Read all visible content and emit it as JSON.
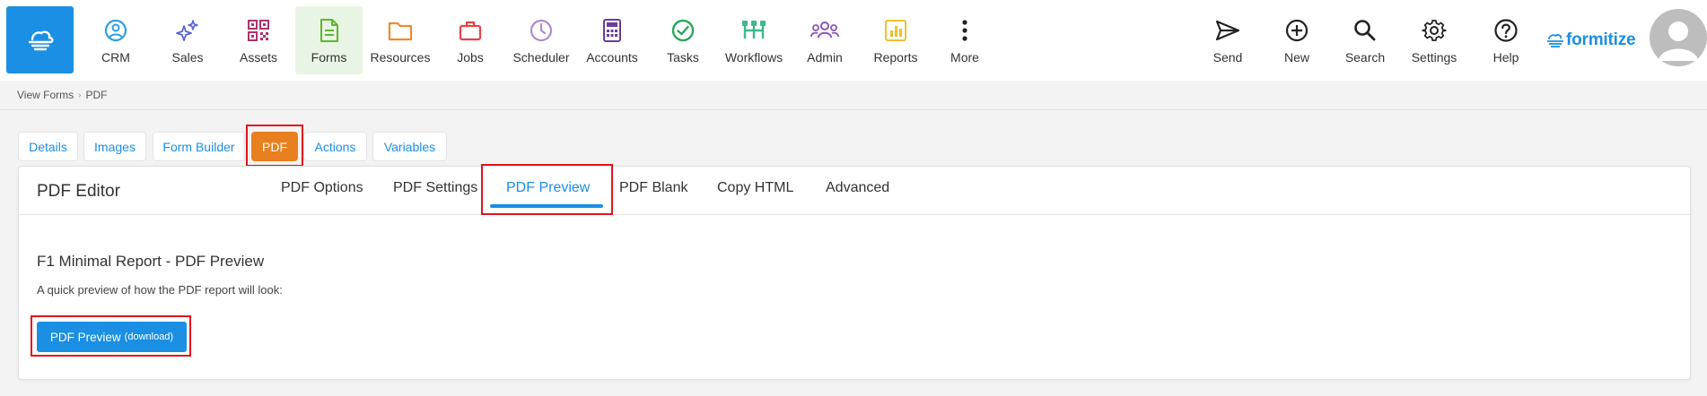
{
  "nav": {
    "items": [
      {
        "label": "CRM",
        "icon": "smile-icon",
        "color": "#2aa0e0"
      },
      {
        "label": "Sales",
        "icon": "sparkles-icon",
        "color": "#5a63d8"
      },
      {
        "label": "Assets",
        "icon": "qr-code-icon",
        "color": "#b0306e"
      },
      {
        "label": "Forms",
        "icon": "document-icon",
        "color": "#5cb82e"
      },
      {
        "label": "Resources",
        "icon": "folder-icon",
        "color": "#f28a2e"
      },
      {
        "label": "Jobs",
        "icon": "briefcase-icon",
        "color": "#e8424a"
      },
      {
        "label": "Scheduler",
        "icon": "clock-icon",
        "color": "#b08ad0"
      },
      {
        "label": "Accounts",
        "icon": "calculator-icon",
        "color": "#6a3c9a"
      },
      {
        "label": "Tasks",
        "icon": "check-circle-icon",
        "color": "#2aa85a"
      },
      {
        "label": "Workflows",
        "icon": "workflow-icon",
        "color": "#3cb88a"
      },
      {
        "label": "Admin",
        "icon": "users-icon",
        "color": "#8a54b8"
      },
      {
        "label": "Reports",
        "icon": "bar-chart-icon",
        "color": "#f2c02e"
      },
      {
        "label": "More",
        "icon": "more-vertical-icon",
        "color": "#222222"
      }
    ],
    "right_items": [
      {
        "label": "Send",
        "icon": "send-icon"
      },
      {
        "label": "New",
        "icon": "plus-circle-icon"
      },
      {
        "label": "Search",
        "icon": "search-icon"
      },
      {
        "label": "Settings",
        "icon": "gear-icon"
      },
      {
        "label": "Help",
        "icon": "help-circle-icon"
      }
    ],
    "brand": "formitize",
    "active": "Forms"
  },
  "breadcrumb": {
    "items": [
      "View Forms",
      "PDF"
    ]
  },
  "tabs": {
    "items": [
      "Details",
      "Images",
      "Form Builder",
      "PDF",
      "Actions",
      "Variables"
    ],
    "active": "PDF"
  },
  "editor": {
    "title": "PDF Editor",
    "subtabs": [
      "PDF Options",
      "PDF Settings",
      "PDF Preview",
      "PDF Blank",
      "Copy HTML",
      "Advanced"
    ],
    "active_subtab": "PDF Preview",
    "section_title": "F1 Minimal Report - PDF Preview",
    "section_desc": "A quick preview of how the PDF report will look:",
    "button_label": "PDF Preview",
    "button_suffix": "(download)"
  },
  "colors": {
    "accent": "#1a8fe3",
    "active_tab": "#e8801f",
    "highlight": "#e0141e"
  }
}
